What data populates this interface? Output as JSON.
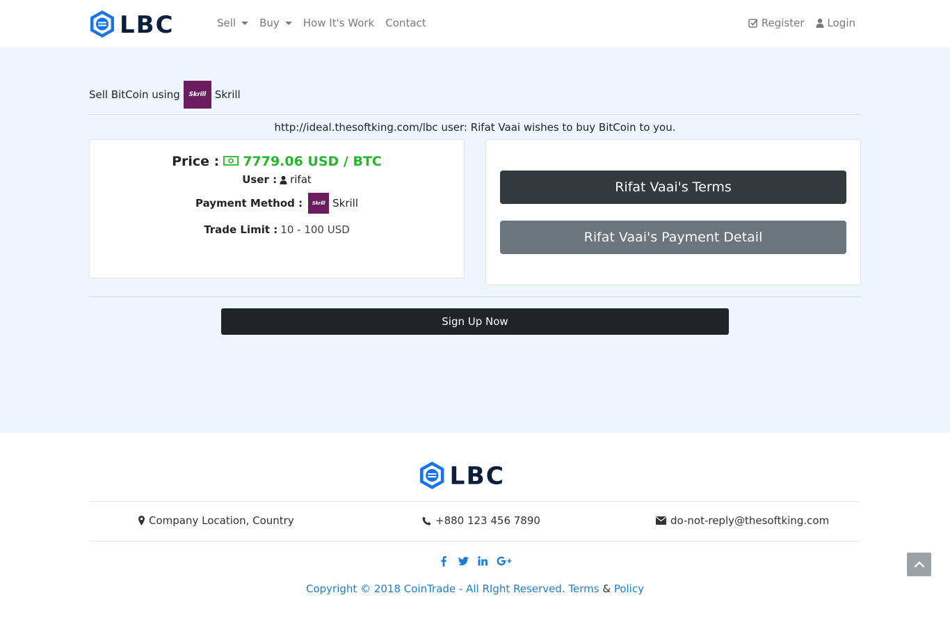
{
  "brand": {
    "logo_text": "LBC",
    "primary_color": "#1a73e8",
    "dark_color": "#0b1e3b"
  },
  "nav": {
    "items": [
      {
        "label": "Sell",
        "dropdown": true
      },
      {
        "label": "Buy",
        "dropdown": true
      },
      {
        "label": "How It's Work",
        "dropdown": false
      },
      {
        "label": "Contact",
        "dropdown": false
      }
    ],
    "register_label": "Register",
    "login_label": "Login"
  },
  "page": {
    "heading_prefix": "Sell BitCoin using",
    "heading_method": "Skrill",
    "skrill_badge": "Skrill",
    "info_line": "http://ideal.thesoftking.com/lbc user: Rifat Vaai wishes to buy BitCoin to you."
  },
  "offer": {
    "price_label": "Price :",
    "price_value": "7779.06 USD / BTC",
    "user_label": "User :",
    "user_value": "rifat",
    "payment_label": "Payment Method :",
    "payment_value": "Skrill",
    "trade_limit_label": "Trade Limit :",
    "trade_limit_value": "10 - 100 USD",
    "price_color": "#28b62c"
  },
  "actions": {
    "terms_label": "Rifat Vaai's Terms",
    "payment_detail_label": "Rifat Vaai's Payment Detail",
    "signup_label": "Sign Up Now"
  },
  "footer": {
    "location": "Company Location, Country",
    "phone": "+880 123 456 7890",
    "email": "do-not-reply@thesoftking.com",
    "social": [
      "facebook-icon",
      "twitter-icon",
      "linkedin-icon",
      "google-plus-icon"
    ],
    "copyright": "Copyright © 2018 CoinTrade - All RIght Reserved.",
    "terms_link": "Terms",
    "amp": "&",
    "policy_link": "Policy"
  }
}
